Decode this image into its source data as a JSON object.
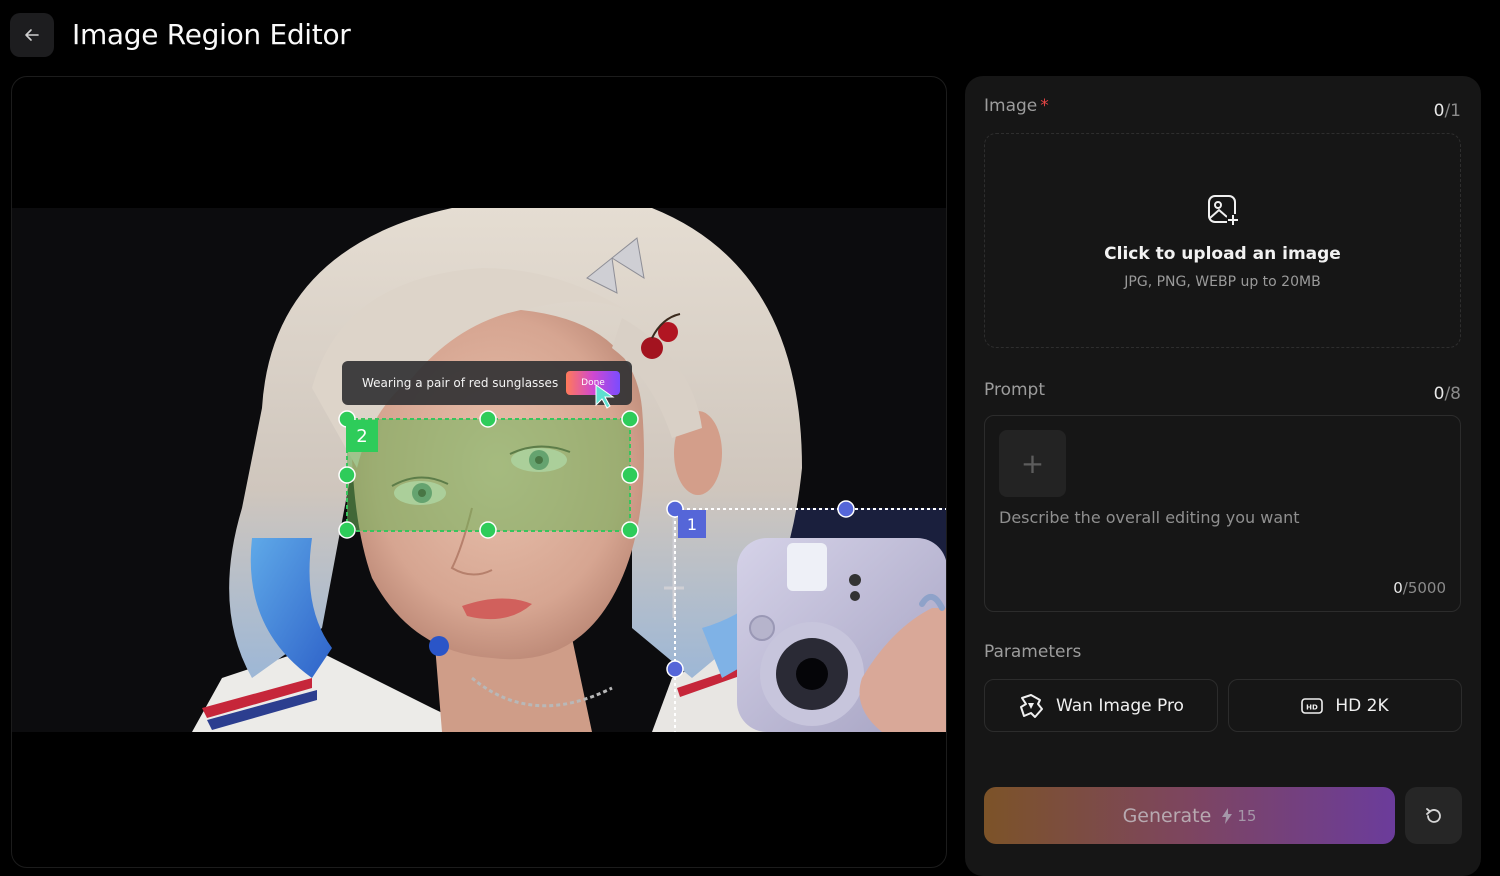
{
  "header": {
    "title": "Image Region Editor"
  },
  "canvas": {
    "prompt_bubble_text": "Wearing a pair of red sunglasses",
    "done_label": "Done",
    "regions": [
      {
        "label": "2",
        "color": "#2ecc5a"
      },
      {
        "label": "1",
        "color": "#5566d8"
      }
    ]
  },
  "image_section": {
    "label": "Image",
    "count_current": "0",
    "count_total": "/1",
    "upload_title": "Click to upload an image",
    "upload_subtitle": "JPG, PNG, WEBP up to 20MB"
  },
  "prompt_section": {
    "label": "Prompt",
    "count_current": "0",
    "count_total": "/8",
    "placeholder": "Describe the overall editing you want",
    "char_current": "0",
    "char_total": "/5000"
  },
  "parameters": {
    "label": "Parameters",
    "model_label": "Wan Image Pro",
    "resolution_label": "HD 2K"
  },
  "actions": {
    "generate_label": "Generate",
    "generate_cost": "15"
  },
  "colors": {
    "accent_region_green": "#2ecc5a",
    "accent_region_blue": "#5566d8",
    "required_star": "#e64545"
  }
}
